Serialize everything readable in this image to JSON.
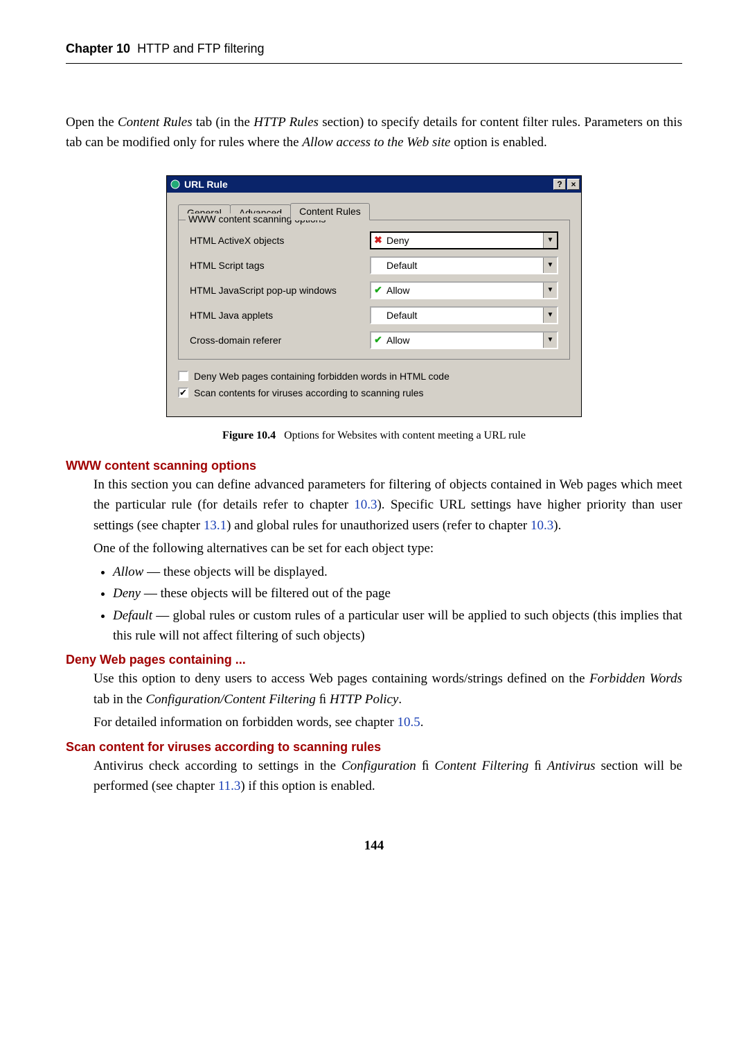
{
  "header": {
    "chapter": "Chapter 10",
    "title": "HTTP and FTP filtering"
  },
  "intro": {
    "t1": "Open the ",
    "i1": "Content Rules",
    "t2": " tab (in the ",
    "i2": "HTTP Rules",
    "t3": " section) to specify details for content filter rules. Parameters on this tab can be modified only for rules where the ",
    "i3": "Allow access to the Web site",
    "t4": " option is enabled."
  },
  "dialog": {
    "title": "URL Rule",
    "tabs": [
      "General",
      "Advanced",
      "Content Rules"
    ],
    "groupTitle": "WWW content scanning options",
    "rows": [
      {
        "label": "HTML ActiveX objects",
        "value": "Deny",
        "icon": "deny",
        "hl": true
      },
      {
        "label": "HTML Script tags",
        "value": "Default",
        "icon": "",
        "hl": false
      },
      {
        "label": "HTML JavaScript pop-up windows",
        "value": "Allow",
        "icon": "allow",
        "hl": false
      },
      {
        "label": "HTML Java applets",
        "value": "Default",
        "icon": "",
        "hl": false
      },
      {
        "label": "Cross-domain referer",
        "value": "Allow",
        "icon": "allow",
        "hl": false
      }
    ],
    "chk1": "Deny Web pages containing forbidden words in HTML code",
    "chk2": "Scan contents for viruses according to scanning rules"
  },
  "caption": {
    "fig": "Figure 10.4",
    "text": "Options for Websites with content meeting a URL rule"
  },
  "sections": {
    "s1": {
      "heading": "WWW content scanning options",
      "p1a": "In this section you can define advanced parameters for filtering of objects contained in Web pages which meet the particular rule (for details refer to chapter ",
      "link1": "10.3",
      "p1b": "). Specific URL settings have higher priority than user settings (see chapter ",
      "link2": "13.1",
      "p1c": ") and global rules for unauthorized users (refer to chapter ",
      "link3": "10.3",
      "p1d": ").",
      "p2": "One of the following alternatives can be set for each object type:",
      "b1i": "Allow",
      "b1": " — these objects will be displayed.",
      "b2i": "Deny",
      "b2": " — these objects will be filtered out of the page",
      "b3i": "Default",
      "b3": " — global rules or custom rules of a particular user will be applied to such objects (this implies that this rule will not affect filtering of such objects)"
    },
    "s2": {
      "heading": "Deny Web pages containing ...",
      "p1a": "Use this option to deny users to access Web pages containing words/strings defined on the ",
      "i1": "Forbidden Words",
      "p1b": " tab in the ",
      "i2": "Configuration/Content Filtering",
      "p1c": " ﬁ ",
      "i3": "HTTP Policy",
      "p1d": ".",
      "p2a": "For detailed information on forbidden words, see chapter ",
      "link1": "10.5",
      "p2b": "."
    },
    "s3": {
      "heading": "Scan content for viruses according to scanning rules",
      "p1a": "Antivirus check according to settings in the ",
      "i1": "Configuration",
      "p1b": " ﬁ ",
      "i2": "Content Filtering",
      "p1c": " ﬁ ",
      "i3": "Antivirus",
      "p1d": " section will be performed (see chapter ",
      "link1": "11.3",
      "p1e": ") if this option is enabled."
    }
  },
  "pageNumber": "144"
}
